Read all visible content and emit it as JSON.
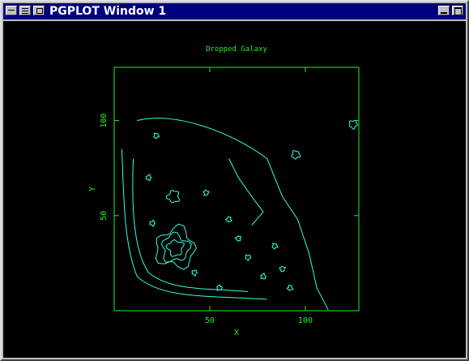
{
  "window": {
    "title": "PGPLOT Window 1",
    "controls": [
      "system-menu",
      "menu",
      "restore",
      "minimize",
      "maximize"
    ]
  },
  "colors": {
    "titlebar": "#000080",
    "plot_background": "#000000",
    "axes": "#22ee22",
    "contours": "#33ffdd"
  },
  "chart_data": {
    "type": "contour",
    "title": "Dropped Galaxy",
    "xlabel": "X",
    "ylabel": "Y",
    "xlim": [
      0,
      128
    ],
    "ylim": [
      0,
      128
    ],
    "x_ticks": [
      50,
      100
    ],
    "y_ticks": [
      50,
      100
    ],
    "x_tick_labels": [
      "50",
      "100"
    ],
    "y_tick_labels": [
      "50",
      "100"
    ],
    "grid": false,
    "features": [
      {
        "kind": "outer-boundary",
        "shape": "curved wedge"
      },
      {
        "kind": "ring",
        "center": [
          32,
          33
        ],
        "radius": 10
      },
      {
        "kind": "ring",
        "center": [
          32,
          33
        ],
        "radius": 7
      },
      {
        "kind": "ring",
        "center": [
          32,
          33
        ],
        "radius": 4
      },
      {
        "kind": "knot",
        "center": [
          31,
          60
        ],
        "radius": 3
      },
      {
        "kind": "knot",
        "center": [
          95,
          82
        ],
        "radius": 2
      },
      {
        "kind": "knot",
        "center": [
          125,
          98
        ],
        "radius": 2
      }
    ]
  }
}
